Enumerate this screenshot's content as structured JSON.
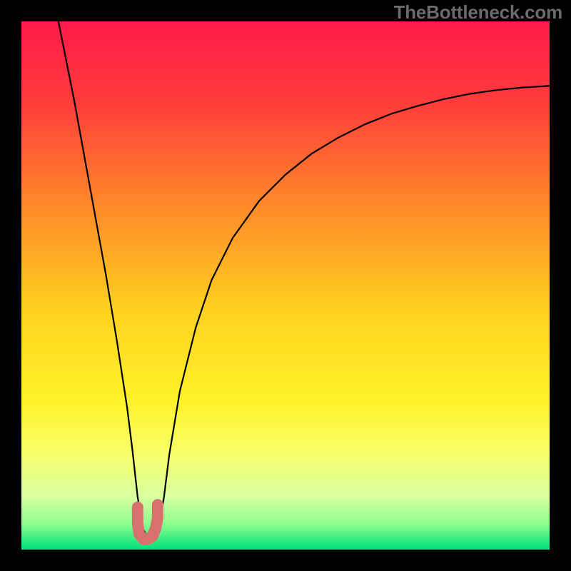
{
  "watermark": "TheBottleneck.com",
  "chart_data": {
    "type": "line",
    "title": "",
    "xlabel": "",
    "ylabel": "",
    "xlim": [
      0,
      100
    ],
    "ylim": [
      0,
      100
    ],
    "series": [
      {
        "name": "bottleneck-curve",
        "x": [
          7,
          8,
          10,
          12,
          14,
          16,
          18,
          20,
          21,
          22,
          23,
          24,
          25,
          26,
          27,
          28,
          30,
          33,
          36,
          40,
          45,
          50,
          55,
          60,
          65,
          70,
          75,
          80,
          85,
          90,
          95,
          100
        ],
        "y": [
          100,
          95,
          85,
          74,
          63,
          52,
          40,
          27,
          19,
          10,
          4,
          2,
          2,
          4,
          10,
          18,
          30,
          42,
          51,
          59,
          66,
          71,
          75,
          78,
          80.5,
          82.5,
          84,
          85.3,
          86.3,
          87,
          87.5,
          87.8
        ]
      },
      {
        "name": "optimal-range-marker",
        "x": [
          22.0,
          22.0,
          22.3,
          23.0,
          24.0,
          24.8,
          25.4,
          25.8,
          25.8
        ],
        "y": [
          8.0,
          5.0,
          3.0,
          2.0,
          2.0,
          2.5,
          4.0,
          6.0,
          8.5
        ]
      }
    ],
    "gradient_stops": [
      {
        "offset": 0.0,
        "color": "#ff1a4b"
      },
      {
        "offset": 0.15,
        "color": "#ff3b3b"
      },
      {
        "offset": 0.35,
        "color": "#ff8a2a"
      },
      {
        "offset": 0.55,
        "color": "#ffd21f"
      },
      {
        "offset": 0.72,
        "color": "#fff22a"
      },
      {
        "offset": 0.82,
        "color": "#f7ff6a"
      },
      {
        "offset": 0.9,
        "color": "#d8ffa0"
      },
      {
        "offset": 0.95,
        "color": "#8fff8f"
      },
      {
        "offset": 1.0,
        "color": "#00e07a"
      }
    ],
    "marker_color": "#d6716d",
    "curve_color": "#000000"
  }
}
